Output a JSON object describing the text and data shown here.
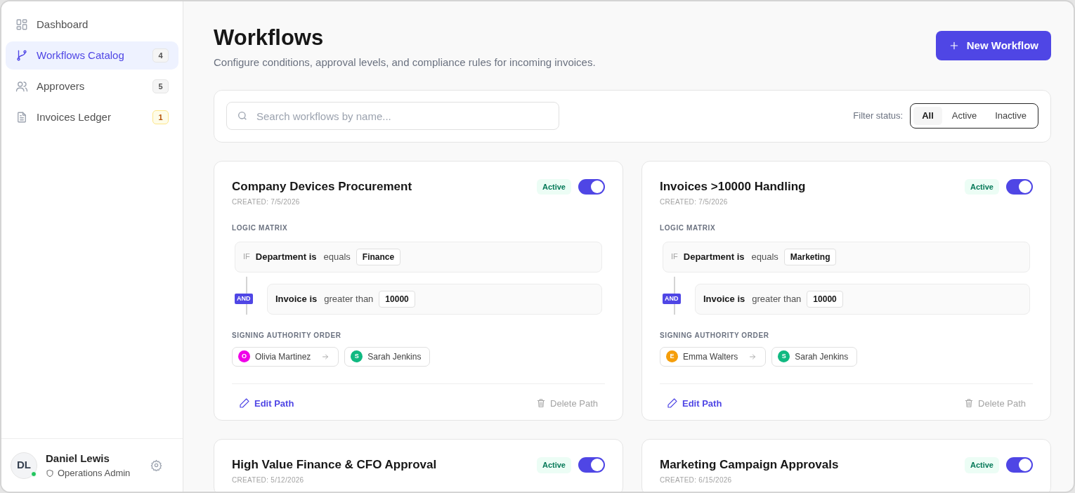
{
  "sidebar": {
    "items": [
      {
        "label": "Dashboard",
        "selected": false
      },
      {
        "label": "Workflows Catalog",
        "selected": true,
        "badge": "4",
        "alert": false
      },
      {
        "label": "Approvers",
        "selected": false,
        "badge": "5",
        "alert": false
      },
      {
        "label": "Invoices Ledger",
        "selected": false,
        "badge": "1",
        "alert": true
      }
    ],
    "user": {
      "initials": "DL",
      "name": "Daniel Lewis",
      "role": "Operations Admin",
      "online": true
    }
  },
  "header": {
    "title": "Workflows",
    "subtitle": "Configure conditions, approval levels, and compliance rules for incoming invoices.",
    "new_button": "New Workflow"
  },
  "toolbar": {
    "search": {
      "placeholder": "Search workflows by name..."
    },
    "filter_label": "Filter status:",
    "filters": [
      {
        "label": "All",
        "selected": true
      },
      {
        "label": "Active",
        "selected": false
      },
      {
        "label": "Inactive",
        "selected": false
      }
    ]
  },
  "workflows": [
    {
      "title": "Company Devices Procurement",
      "created": "CREATED: 7/5/2026",
      "status": "Active",
      "on": true,
      "logic_label": "LOGIC MATRIX",
      "conditions": [
        {
          "kind": "if",
          "prefix": "IF",
          "field": "Department is",
          "operator": "equals",
          "value": "Finance"
        },
        {
          "kind": "and",
          "prefix": "AND",
          "field": "Invoice is",
          "operator": "greater than",
          "value": "10000"
        }
      ],
      "signers_label": "SIGNING AUTHORITY ORDER",
      "signers": [
        {
          "initial": "O",
          "name": "Olivia Martinez",
          "color": "#f000e8"
        },
        {
          "initial": "S",
          "name": "Sarah Jenkins",
          "color": "#10b981"
        }
      ],
      "edit": "Edit Path",
      "delete": "Delete Path"
    },
    {
      "title": "Invoices >10000 Handling",
      "created": "CREATED: 7/5/2026",
      "status": "Active",
      "on": true,
      "logic_label": "LOGIC MATRIX",
      "conditions": [
        {
          "kind": "if",
          "prefix": "IF",
          "field": "Department is",
          "operator": "equals",
          "value": "Marketing"
        },
        {
          "kind": "and",
          "prefix": "AND",
          "field": "Invoice is",
          "operator": "greater than",
          "value": "10000"
        }
      ],
      "signers_label": "SIGNING AUTHORITY ORDER",
      "signers": [
        {
          "initial": "E",
          "name": "Emma Walters",
          "color": "#f59e0b"
        },
        {
          "initial": "S",
          "name": "Sarah Jenkins",
          "color": "#10b981"
        }
      ],
      "edit": "Edit Path",
      "delete": "Delete Path"
    },
    {
      "title": "High Value Finance & CFO Approval",
      "created": "CREATED: 5/12/2026",
      "status": "Active",
      "on": true
    },
    {
      "title": "Marketing Campaign Approvals",
      "created": "CREATED: 6/15/2026",
      "status": "Active",
      "on": true
    }
  ]
}
